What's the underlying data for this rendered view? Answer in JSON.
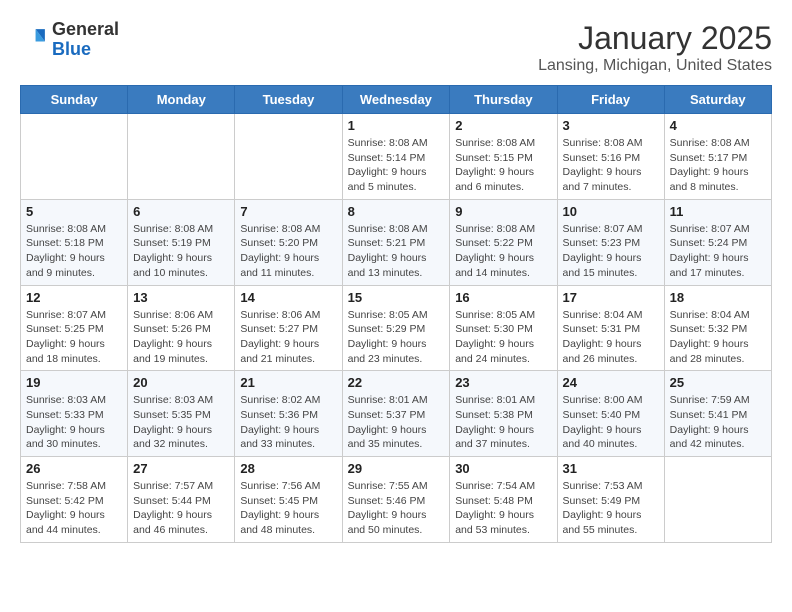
{
  "header": {
    "logo_general": "General",
    "logo_blue": "Blue",
    "month": "January 2025",
    "location": "Lansing, Michigan, United States"
  },
  "weekdays": [
    "Sunday",
    "Monday",
    "Tuesday",
    "Wednesday",
    "Thursday",
    "Friday",
    "Saturday"
  ],
  "weeks": [
    [
      {
        "day": "",
        "info": ""
      },
      {
        "day": "",
        "info": ""
      },
      {
        "day": "",
        "info": ""
      },
      {
        "day": "1",
        "info": "Sunrise: 8:08 AM\nSunset: 5:14 PM\nDaylight: 9 hours\nand 5 minutes."
      },
      {
        "day": "2",
        "info": "Sunrise: 8:08 AM\nSunset: 5:15 PM\nDaylight: 9 hours\nand 6 minutes."
      },
      {
        "day": "3",
        "info": "Sunrise: 8:08 AM\nSunset: 5:16 PM\nDaylight: 9 hours\nand 7 minutes."
      },
      {
        "day": "4",
        "info": "Sunrise: 8:08 AM\nSunset: 5:17 PM\nDaylight: 9 hours\nand 8 minutes."
      }
    ],
    [
      {
        "day": "5",
        "info": "Sunrise: 8:08 AM\nSunset: 5:18 PM\nDaylight: 9 hours\nand 9 minutes."
      },
      {
        "day": "6",
        "info": "Sunrise: 8:08 AM\nSunset: 5:19 PM\nDaylight: 9 hours\nand 10 minutes."
      },
      {
        "day": "7",
        "info": "Sunrise: 8:08 AM\nSunset: 5:20 PM\nDaylight: 9 hours\nand 11 minutes."
      },
      {
        "day": "8",
        "info": "Sunrise: 8:08 AM\nSunset: 5:21 PM\nDaylight: 9 hours\nand 13 minutes."
      },
      {
        "day": "9",
        "info": "Sunrise: 8:08 AM\nSunset: 5:22 PM\nDaylight: 9 hours\nand 14 minutes."
      },
      {
        "day": "10",
        "info": "Sunrise: 8:07 AM\nSunset: 5:23 PM\nDaylight: 9 hours\nand 15 minutes."
      },
      {
        "day": "11",
        "info": "Sunrise: 8:07 AM\nSunset: 5:24 PM\nDaylight: 9 hours\nand 17 minutes."
      }
    ],
    [
      {
        "day": "12",
        "info": "Sunrise: 8:07 AM\nSunset: 5:25 PM\nDaylight: 9 hours\nand 18 minutes."
      },
      {
        "day": "13",
        "info": "Sunrise: 8:06 AM\nSunset: 5:26 PM\nDaylight: 9 hours\nand 19 minutes."
      },
      {
        "day": "14",
        "info": "Sunrise: 8:06 AM\nSunset: 5:27 PM\nDaylight: 9 hours\nand 21 minutes."
      },
      {
        "day": "15",
        "info": "Sunrise: 8:05 AM\nSunset: 5:29 PM\nDaylight: 9 hours\nand 23 minutes."
      },
      {
        "day": "16",
        "info": "Sunrise: 8:05 AM\nSunset: 5:30 PM\nDaylight: 9 hours\nand 24 minutes."
      },
      {
        "day": "17",
        "info": "Sunrise: 8:04 AM\nSunset: 5:31 PM\nDaylight: 9 hours\nand 26 minutes."
      },
      {
        "day": "18",
        "info": "Sunrise: 8:04 AM\nSunset: 5:32 PM\nDaylight: 9 hours\nand 28 minutes."
      }
    ],
    [
      {
        "day": "19",
        "info": "Sunrise: 8:03 AM\nSunset: 5:33 PM\nDaylight: 9 hours\nand 30 minutes."
      },
      {
        "day": "20",
        "info": "Sunrise: 8:03 AM\nSunset: 5:35 PM\nDaylight: 9 hours\nand 32 minutes."
      },
      {
        "day": "21",
        "info": "Sunrise: 8:02 AM\nSunset: 5:36 PM\nDaylight: 9 hours\nand 33 minutes."
      },
      {
        "day": "22",
        "info": "Sunrise: 8:01 AM\nSunset: 5:37 PM\nDaylight: 9 hours\nand 35 minutes."
      },
      {
        "day": "23",
        "info": "Sunrise: 8:01 AM\nSunset: 5:38 PM\nDaylight: 9 hours\nand 37 minutes."
      },
      {
        "day": "24",
        "info": "Sunrise: 8:00 AM\nSunset: 5:40 PM\nDaylight: 9 hours\nand 40 minutes."
      },
      {
        "day": "25",
        "info": "Sunrise: 7:59 AM\nSunset: 5:41 PM\nDaylight: 9 hours\nand 42 minutes."
      }
    ],
    [
      {
        "day": "26",
        "info": "Sunrise: 7:58 AM\nSunset: 5:42 PM\nDaylight: 9 hours\nand 44 minutes."
      },
      {
        "day": "27",
        "info": "Sunrise: 7:57 AM\nSunset: 5:44 PM\nDaylight: 9 hours\nand 46 minutes."
      },
      {
        "day": "28",
        "info": "Sunrise: 7:56 AM\nSunset: 5:45 PM\nDaylight: 9 hours\nand 48 minutes."
      },
      {
        "day": "29",
        "info": "Sunrise: 7:55 AM\nSunset: 5:46 PM\nDaylight: 9 hours\nand 50 minutes."
      },
      {
        "day": "30",
        "info": "Sunrise: 7:54 AM\nSunset: 5:48 PM\nDaylight: 9 hours\nand 53 minutes."
      },
      {
        "day": "31",
        "info": "Sunrise: 7:53 AM\nSunset: 5:49 PM\nDaylight: 9 hours\nand 55 minutes."
      },
      {
        "day": "",
        "info": ""
      }
    ]
  ]
}
